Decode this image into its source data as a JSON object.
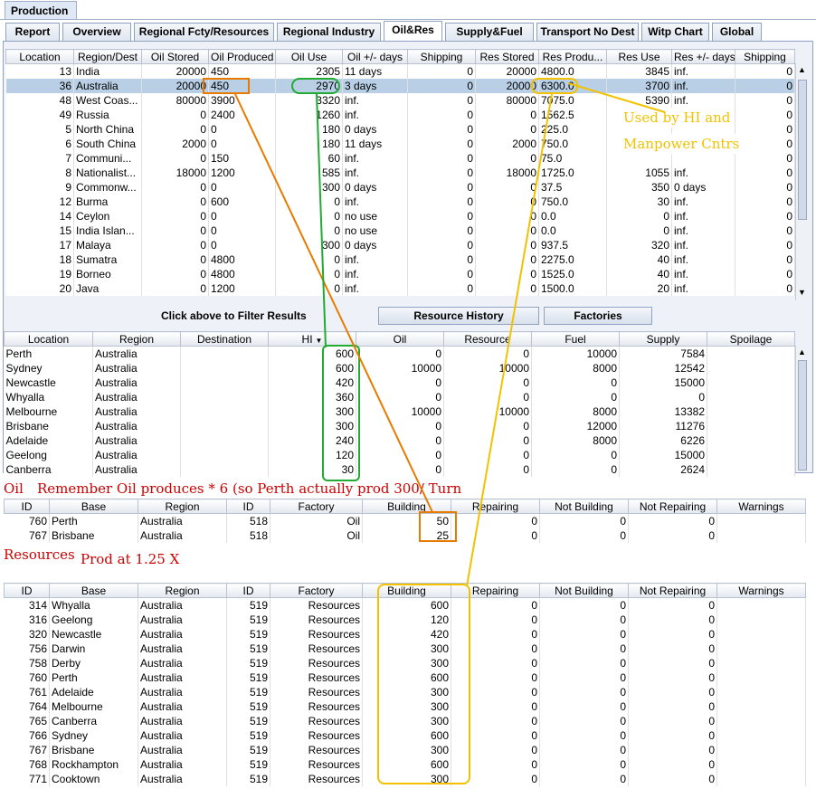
{
  "app_tab": "Production",
  "tabs": [
    "Report",
    "Overview",
    "Regional Fcty/Resources",
    "Regional Industry",
    "Oil&Res",
    "Supply&Fuel",
    "Transport No Dest",
    "Witp Chart",
    "Global"
  ],
  "active_tab": "Oil&Res",
  "top_table": {
    "headers": [
      "Location",
      "Region/Dest",
      "Oil Stored",
      "Oil Produced",
      "Oil Use",
      "Oil +/- days",
      "Shipping",
      "Res Stored",
      "Res Produ...",
      "Res Use",
      "Res +/- days",
      "Shipping"
    ],
    "rows": [
      [
        "13",
        "India",
        "20000",
        "450",
        "2305",
        "11 days",
        "0",
        "20000",
        "4800.0",
        "3845",
        "inf.",
        "0"
      ],
      [
        "36",
        "Australia",
        "20000",
        "450",
        "2970",
        "3 days",
        "0",
        "20000",
        "6300.0",
        "3700",
        "inf.",
        "0"
      ],
      [
        "48",
        "West Coas...",
        "80000",
        "3900",
        "3320",
        "inf.",
        "0",
        "80000",
        "7075.0",
        "5390",
        "inf.",
        "0"
      ],
      [
        "49",
        "Russia",
        "0",
        "2400",
        "1260",
        "inf.",
        "0",
        "0",
        "1562.5",
        "",
        "",
        "0"
      ],
      [
        "5",
        "North China",
        "0",
        "0",
        "180",
        "0 days",
        "0",
        "0",
        "225.0",
        "",
        "",
        "0"
      ],
      [
        "6",
        "South China",
        "2000",
        "0",
        "180",
        "11 days",
        "0",
        "2000",
        "750.0",
        "",
        "",
        "0"
      ],
      [
        "7",
        "Communi...",
        "0",
        "150",
        "60",
        "inf.",
        "0",
        "0",
        "75.0",
        "",
        "",
        "0"
      ],
      [
        "8",
        "Nationalist...",
        "18000",
        "1200",
        "585",
        "inf.",
        "0",
        "18000",
        "1725.0",
        "1055",
        "inf.",
        "0"
      ],
      [
        "9",
        "Commonw...",
        "0",
        "0",
        "300",
        "0 days",
        "0",
        "0",
        "37.5",
        "350",
        "0 days",
        "0"
      ],
      [
        "12",
        "Burma",
        "0",
        "600",
        "0",
        "inf.",
        "0",
        "0",
        "750.0",
        "30",
        "inf.",
        "0"
      ],
      [
        "14",
        "Ceylon",
        "0",
        "0",
        "0",
        "no use",
        "0",
        "0",
        "0.0",
        "0",
        "inf.",
        "0"
      ],
      [
        "15",
        "India Islan...",
        "0",
        "0",
        "0",
        "no use",
        "0",
        "0",
        "0.0",
        "0",
        "inf.",
        "0"
      ],
      [
        "17",
        "Malaya",
        "0",
        "0",
        "300",
        "0 days",
        "0",
        "0",
        "937.5",
        "320",
        "inf.",
        "0"
      ],
      [
        "18",
        "Sumatra",
        "0",
        "4800",
        "0",
        "inf.",
        "0",
        "0",
        "2275.0",
        "40",
        "inf.",
        "0"
      ],
      [
        "19",
        "Borneo",
        "0",
        "4800",
        "0",
        "inf.",
        "0",
        "0",
        "1525.0",
        "40",
        "inf.",
        "0"
      ],
      [
        "20",
        "Java",
        "0",
        "1200",
        "0",
        "inf.",
        "0",
        "0",
        "1500.0",
        "20",
        "inf.",
        "0"
      ]
    ]
  },
  "filter_hint": "Click above to Filter Results",
  "buttons": {
    "resource_history": "Resource History",
    "factories": "Factories"
  },
  "middle_table": {
    "headers": [
      "Location",
      "Region",
      "Destination",
      "HI",
      "Oil",
      "Resource",
      "Fuel",
      "Supply",
      "Spoilage"
    ],
    "sort_indicator": "▼",
    "rows": [
      [
        "Perth",
        "Australia",
        "",
        "600",
        "0",
        "0",
        "10000",
        "7584",
        ""
      ],
      [
        "Sydney",
        "Australia",
        "",
        "600",
        "10000",
        "10000",
        "8000",
        "12542",
        ""
      ],
      [
        "Newcastle",
        "Australia",
        "",
        "420",
        "0",
        "0",
        "0",
        "15000",
        ""
      ],
      [
        "Whyalla",
        "Australia",
        "",
        "360",
        "0",
        "0",
        "0",
        "0",
        ""
      ],
      [
        "Melbourne",
        "Australia",
        "",
        "300",
        "10000",
        "10000",
        "8000",
        "13382",
        ""
      ],
      [
        "Brisbane",
        "Australia",
        "",
        "300",
        "0",
        "0",
        "12000",
        "11276",
        ""
      ],
      [
        "Adelaide",
        "Australia",
        "",
        "240",
        "0",
        "0",
        "8000",
        "6226",
        ""
      ],
      [
        "Geelong",
        "Australia",
        "",
        "120",
        "0",
        "0",
        "0",
        "15000",
        ""
      ],
      [
        "Canberra",
        "Australia",
        "",
        "30",
        "0",
        "0",
        "0",
        "2624",
        ""
      ]
    ]
  },
  "notes": {
    "oil_label": "Oil",
    "oil_note": "Remember Oil produces * 6  (so Perth actually prod 300/ Turn",
    "res_label": "Resources",
    "res_note": "Prod at 1.25 X",
    "yellow_1": "Used by HI and",
    "yellow_2": "Manpower Cntrs"
  },
  "oil_table": {
    "headers": [
      "ID",
      "Base",
      "Region",
      "ID",
      "Factory",
      "Building",
      "Repairing",
      "Not Building",
      "Not Repairing",
      "Warnings"
    ],
    "rows": [
      [
        "760",
        "Perth",
        "Australia",
        "518",
        "Oil",
        "50",
        "0",
        "0",
        "0",
        ""
      ],
      [
        "767",
        "Brisbane",
        "Australia",
        "518",
        "Oil",
        "25",
        "0",
        "0",
        "0",
        ""
      ]
    ]
  },
  "res_table": {
    "headers": [
      "ID",
      "Base",
      "Region",
      "ID",
      "Factory",
      "Building",
      "Repairing",
      "Not Building",
      "Not Repairing",
      "Warnings"
    ],
    "rows": [
      [
        "314",
        "Whyalla",
        "Australia",
        "519",
        "Resources",
        "600",
        "0",
        "0",
        "0",
        ""
      ],
      [
        "316",
        "Geelong",
        "Australia",
        "519",
        "Resources",
        "120",
        "0",
        "0",
        "0",
        ""
      ],
      [
        "320",
        "Newcastle",
        "Australia",
        "519",
        "Resources",
        "420",
        "0",
        "0",
        "0",
        ""
      ],
      [
        "756",
        "Darwin",
        "Australia",
        "519",
        "Resources",
        "300",
        "0",
        "0",
        "0",
        ""
      ],
      [
        "758",
        "Derby",
        "Australia",
        "519",
        "Resources",
        "300",
        "0",
        "0",
        "0",
        ""
      ],
      [
        "760",
        "Perth",
        "Australia",
        "519",
        "Resources",
        "600",
        "0",
        "0",
        "0",
        ""
      ],
      [
        "761",
        "Adelaide",
        "Australia",
        "519",
        "Resources",
        "300",
        "0",
        "0",
        "0",
        ""
      ],
      [
        "764",
        "Melbourne",
        "Australia",
        "519",
        "Resources",
        "300",
        "0",
        "0",
        "0",
        ""
      ],
      [
        "765",
        "Canberra",
        "Australia",
        "519",
        "Resources",
        "300",
        "0",
        "0",
        "0",
        ""
      ],
      [
        "766",
        "Sydney",
        "Australia",
        "519",
        "Resources",
        "600",
        "0",
        "0",
        "0",
        ""
      ],
      [
        "767",
        "Brisbane",
        "Australia",
        "519",
        "Resources",
        "300",
        "0",
        "0",
        "0",
        ""
      ],
      [
        "768",
        "Rockhampton",
        "Australia",
        "519",
        "Resources",
        "600",
        "0",
        "0",
        "0",
        ""
      ],
      [
        "771",
        "Cooktown",
        "Australia",
        "519",
        "Resources",
        "300",
        "0",
        "0",
        "0",
        ""
      ]
    ]
  },
  "colors": {
    "selected_row": "#b8cfe5",
    "note_red": "#cc0000",
    "note_yellow": "#f2c200",
    "hl_green": "#22aa33",
    "hl_orange": "#e87a00",
    "hl_yellow": "#f2c200"
  }
}
